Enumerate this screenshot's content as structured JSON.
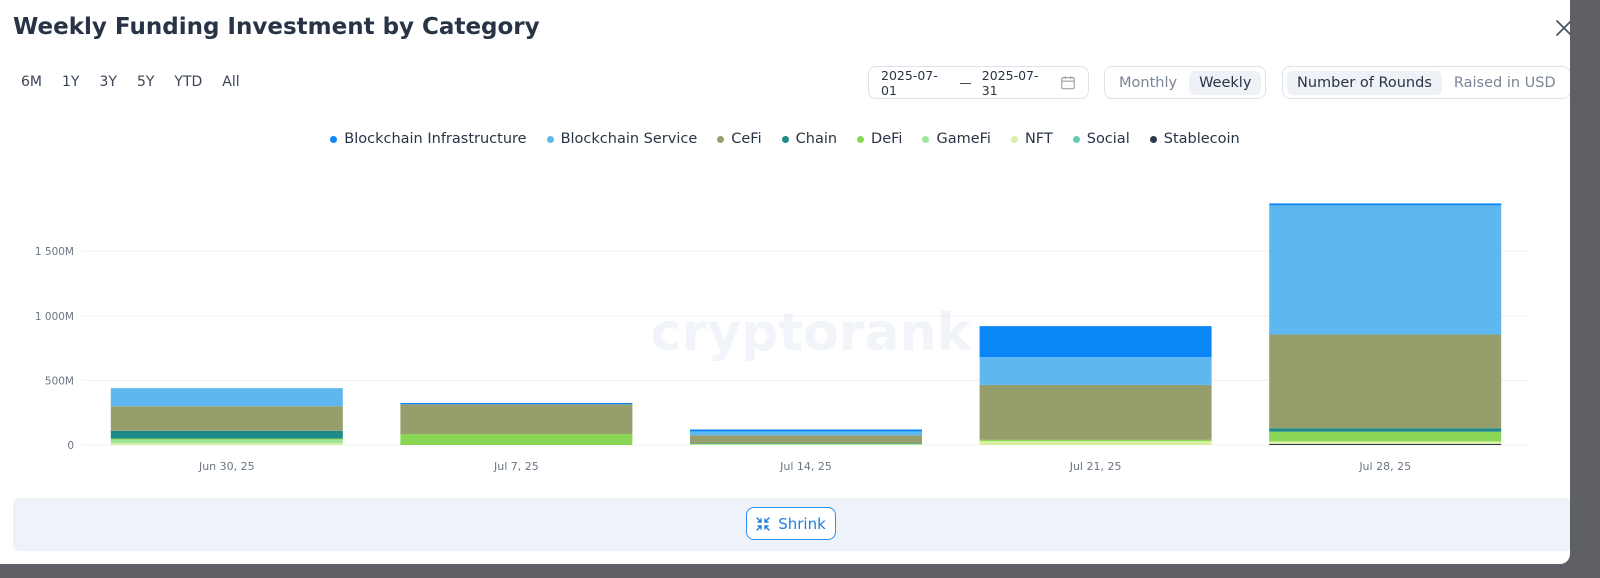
{
  "modal": {
    "title": "Weekly Funding Investment by Category"
  },
  "ranges": [
    "6M",
    "1Y",
    "3Y",
    "5Y",
    "YTD",
    "All"
  ],
  "date_range": {
    "start": "2025-07-01",
    "separator": "—",
    "end": "2025-07-31"
  },
  "period_toggle": {
    "options": [
      "Monthly",
      "Weekly"
    ],
    "selected": "Weekly"
  },
  "metric_toggle": {
    "options": [
      "Number of Rounds",
      "Raised in USD"
    ],
    "selected": "Number of Rounds"
  },
  "watermark": "cryptorank",
  "footer": {
    "shrink_label": "Shrink"
  },
  "icons": {
    "close": "close-icon",
    "calendar": "calendar-icon",
    "shrink": "shrink-arrows-icon"
  },
  "colors": {
    "Blockchain Infrastructure": "#0a86f7",
    "Blockchain Service": "#5eb7ee",
    "CeFi": "#969e6c",
    "Chain": "#1e8a8a",
    "DeFi": "#88d653",
    "GameFi": "#9ee69a",
    "NFT": "#d9f0a3",
    "Social": "#63cdb3",
    "Stablecoin": "#2d3950"
  },
  "chart_data": {
    "type": "bar",
    "stacked": true,
    "categories": [
      "Jun 30, 25",
      "Jul 7, 25",
      "Jul 14, 25",
      "Jul 21, 25",
      "Jul 28, 25"
    ],
    "series": [
      {
        "name": "Stablecoin",
        "values": [
          0,
          0,
          0,
          0,
          8
        ]
      },
      {
        "name": "Social",
        "values": [
          0,
          0,
          0,
          0,
          0
        ]
      },
      {
        "name": "NFT",
        "values": [
          15,
          0,
          5,
          30,
          20
        ]
      },
      {
        "name": "GameFi",
        "values": [
          25,
          0,
          0,
          0,
          0
        ]
      },
      {
        "name": "DeFi",
        "values": [
          10,
          85,
          5,
          10,
          75
        ]
      },
      {
        "name": "Chain",
        "values": [
          60,
          0,
          5,
          0,
          27
        ]
      },
      {
        "name": "CeFi",
        "values": [
          190,
          230,
          60,
          425,
          725
        ]
      },
      {
        "name": "Blockchain Service",
        "values": [
          140,
          0,
          30,
          215,
          1000
        ]
      },
      {
        "name": "Blockchain Infrastructure",
        "values": [
          0,
          10,
          15,
          240,
          15
        ]
      }
    ],
    "legend_order": [
      "Blockchain Infrastructure",
      "Blockchain Service",
      "CeFi",
      "Chain",
      "DeFi",
      "GameFi",
      "NFT",
      "Social",
      "Stablecoin"
    ],
    "y_ticks": [
      {
        "value": 0,
        "label": "0"
      },
      {
        "value": 500,
        "label": "500M"
      },
      {
        "value": 1000,
        "label": "1 000M"
      },
      {
        "value": 1500,
        "label": "1 500M"
      }
    ],
    "ylim": [
      0,
      1850
    ],
    "grid": true,
    "legend_position": "top-center",
    "title": "",
    "xlabel": "",
    "ylabel": ""
  }
}
